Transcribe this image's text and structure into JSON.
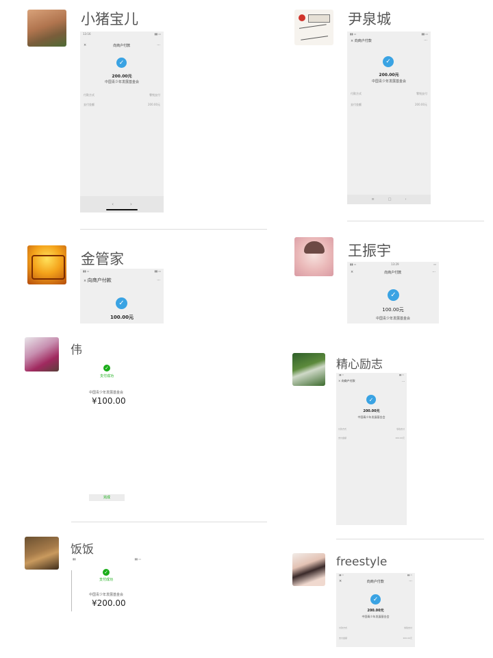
{
  "feed": [
    {
      "author": "小猪宝儿",
      "shot": {
        "time": "13:16",
        "nav_title": "向商户付款",
        "amount": "200.00元",
        "org": "中国青少年发展基金会",
        "rows": [
          {
            "label": "付款方式",
            "value": "零钱支付"
          },
          {
            "label": "支付金额",
            "value": "200.00元"
          }
        ]
      }
    },
    {
      "author": "尹泉城",
      "shot": {
        "nav_title": "向商户付款",
        "amount": "200.00元",
        "org": "中国青少年发展基金会",
        "rows": [
          {
            "label": "付款方式",
            "value": "零钱支付"
          },
          {
            "label": "支付金额",
            "value": "200.00元"
          }
        ]
      }
    },
    {
      "author": "金管家",
      "shot": {
        "nav_title": "向商户付款",
        "amount": "100.00元"
      }
    },
    {
      "author": "王振宇",
      "shot": {
        "time": "13:29",
        "nav_title": "向商户付款",
        "amount": "100.00元",
        "org": "中国青少年发展基金会"
      }
    },
    {
      "author": "伟",
      "shot": {
        "status": "支付成功",
        "org": "中国青少年发展基金会",
        "amount": "¥100.00",
        "button": "完成"
      }
    },
    {
      "author": "精心励志",
      "shot": {
        "nav_title": "向商户付款",
        "amount": "200.00元",
        "org": "中国青少年发展基金会",
        "rows": [
          {
            "label": "付款方式",
            "value": "零钱支付"
          },
          {
            "label": "支付金额",
            "value": "200.00元"
          }
        ]
      }
    },
    {
      "author": "饭饭",
      "shot": {
        "status": "支付成功",
        "org": "中国青少年发展基金会",
        "amount": "¥200.00"
      }
    },
    {
      "author": "freestyle",
      "shot": {
        "nav_title": "向商户付款",
        "amount": "200.00元",
        "org": "中国青少年发展基金会",
        "rows": [
          {
            "label": "付款方式",
            "value": "零钱支付"
          },
          {
            "label": "支付金额",
            "value": "200.00元"
          }
        ]
      }
    }
  ],
  "icons": {
    "close": "×",
    "more": "···",
    "check": "✓",
    "back": "‹",
    "forward": "›"
  },
  "colors": {
    "success_blue": "#3aa3e3",
    "wechat_green": "#1aad19"
  }
}
